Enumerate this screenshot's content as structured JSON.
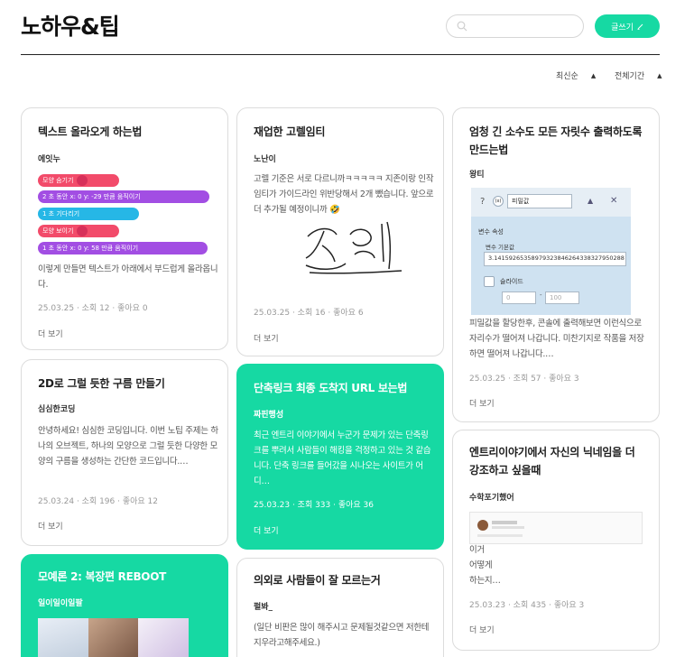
{
  "header": {
    "title": "노하우&팁",
    "search_placeholder": "",
    "write_label": "글쓰기",
    "sort_order": "최신순",
    "sort_period": "전체기간"
  },
  "cards": [
    {
      "title": "텍스트 올라오게 하는법",
      "author": "에잇누",
      "blocks": [
        "모양 숨기기",
        "2 초 동안 x: 0 y: -29 만큼 움직이기",
        "1 초 기다리기",
        "모양 보이기",
        "1 초 동안 x: 0 y: 58 만큼 움직이기"
      ],
      "body": "이렇게 만들면 텍스트가 아래에서 부드럽게 올라옵니다.",
      "meta": "25.03.25 · 소회 12 · 좋아요 0",
      "more": "더 보기"
    },
    {
      "title": "재업한 고렐임티",
      "author": "노난이",
      "body": "고렐 기준은 서로 다르니까ㅋㅋㅋㅋㅋ 지존이랑 인작 임티가 가이드라인 위반당해서 2개 뺐습니다. 앞으로 더 추가될 예정이니까 🤣",
      "meta": "25.03.25 · 소회 16 · 좋아요 6",
      "more": "더 보기"
    },
    {
      "title": "엄청 긴 소수도 모든 자릿수 출력하도록 만드는법",
      "author": "왕티",
      "panel_name": "피밀값",
      "panel_section": "변수 속성",
      "panel_label": "변수 기본값",
      "panel_value": "3.14159265358979323846264338327950288",
      "panel_slider": "슬라이드",
      "panel_min": "0",
      "panel_max": "100",
      "body": "피밀값을 할당한후, 콘솔에 출력해보면 이런식으로 자리수가 떨어져 나갑니다. 미찬기지로 작품을 저장하면 떨어져 나갑니다.…",
      "meta": "25.03.25 · 조회 57 · 좋아요 3",
      "more": "더 보기"
    },
    {
      "title": "2D로 그럴 듯한 구름 만들기",
      "author": "심심한코딩",
      "body": "안녕하세요! 심심한 코딩입니다. 이번 노팁 주제는 하나의 오브젝트, 하나의 모양으로 그럴 듯한 다양한 모양의 구름을 생성하는 간단한 코드입니다.…",
      "meta": "25.03.24 · 소회 196 · 좋아요 12",
      "more": "더 보기"
    },
    {
      "title": "단축링크 최종 도착지 URL 보는법",
      "author": "짜핀행성",
      "body": "최근 엔트리 이야기에서 누군가 문제가 있는 단축링크를 뿌려서 사람들이 해킹을 걱정하고 있는 것 같습니다. 단축 링크를 들어갔을 시나오는 사이트가 어디…",
      "meta": "25.03.23 · 조회 333 · 좋아요 36",
      "more": "더 보기"
    },
    {
      "title": "엔트리이야기에서 자신의 닉네임을 더 강조하고 싶을때",
      "author": "수학포기했어",
      "body": "이거\n어떻게\n하는지…",
      "meta": "25.03.23 · 소회 435 · 좋아요 3",
      "more": "더 보기"
    },
    {
      "title": "모예론 2: 복장편 REBOOT",
      "author": "일이일이일팔"
    },
    {
      "title": "의외로 사람들이 잘 모르는거",
      "author": "펄봐_",
      "body": "(일단 비판은 많이 해주시고 문제될것같으면 저한테 지우라고해주세요.)"
    }
  ]
}
